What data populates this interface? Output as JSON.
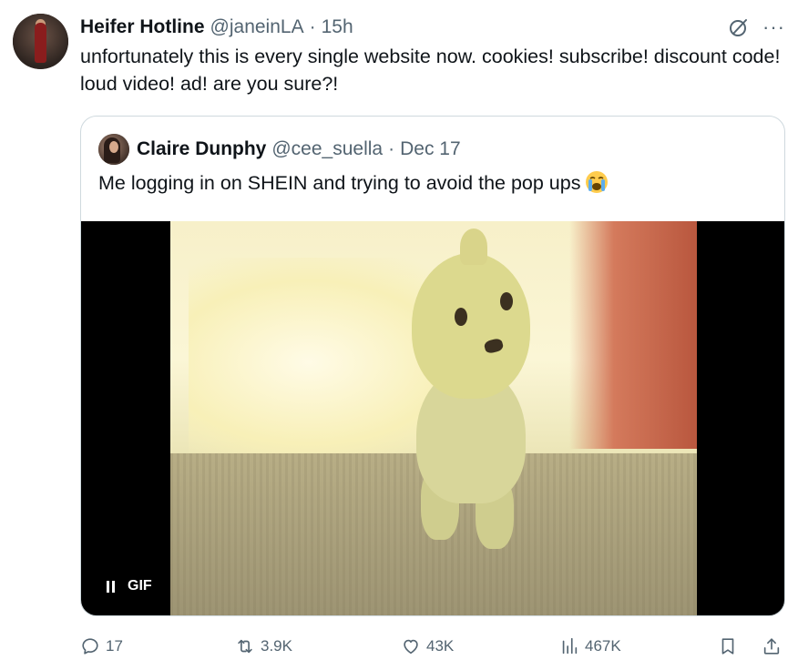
{
  "tweet": {
    "author_name": "Heifer Hotline",
    "author_handle": "@janeinLA",
    "separator": "·",
    "time": "15h",
    "text": "unfortunately this is every single website now. cookies! subscribe! discount code! loud video! ad! are you sure?!"
  },
  "quote": {
    "author_name": "Claire Dunphy",
    "author_handle": "@cee_suella",
    "separator": "·",
    "date": "Dec 17",
    "text": "Me logging in on SHEIN and trying to avoid the pop ups",
    "emoji": "loudly-crying-face",
    "media": {
      "badge_label": "GIF",
      "state": "playing"
    }
  },
  "actions": {
    "replies": "17",
    "reposts": "3.9K",
    "likes": "43K",
    "views": "467K"
  },
  "icons": {
    "grok": "grok-icon",
    "more": "more-icon",
    "reply": "reply-icon",
    "repost": "repost-icon",
    "like": "heart-icon",
    "views": "views-icon",
    "bookmark": "bookmark-icon",
    "share": "share-icon",
    "pause": "pause-icon"
  },
  "colors": {
    "text": "#0f1419",
    "secondary": "#536471",
    "border": "#cfd9de"
  }
}
